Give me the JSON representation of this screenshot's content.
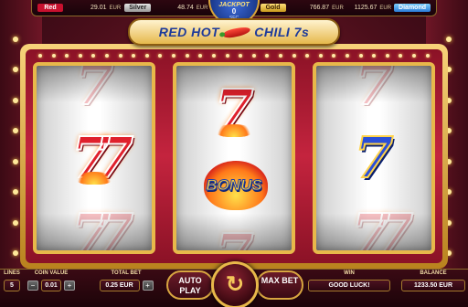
{
  "jackpots": [
    {
      "label": "Red",
      "value": "29.01",
      "currency": "EUR"
    },
    {
      "label": "Silver",
      "value": "48.74",
      "currency": "EUR"
    },
    {
      "label": "Gold",
      "value": "766.87",
      "currency": "EUR"
    },
    {
      "label": "Diamond",
      "value": "1125.67",
      "currency": "EUR"
    }
  ],
  "jackpot_badge": {
    "title": "JACKPOT",
    "number": "0",
    "unit": "SEC"
  },
  "title": {
    "part1": "RED HOT",
    "part2": "CHILI 7s"
  },
  "reels": [
    {
      "symbols": [
        "seven-red",
        "double-seven-red",
        "double-seven-red"
      ]
    },
    {
      "symbols": [
        "seven-red",
        "bonus",
        "seven-red"
      ]
    },
    {
      "symbols": [
        "seven-red",
        "seven-blue",
        "double-seven-red"
      ]
    }
  ],
  "bonus_label": "BONUS",
  "bottom": {
    "lines": {
      "caption": "LINES",
      "value": "5"
    },
    "coin_value": {
      "caption": "COIN VALUE",
      "value": "0.01",
      "minus": "−",
      "plus": "+"
    },
    "total_bet": {
      "caption": "TOTAL BET",
      "value": "0.25 EUR",
      "plus": "+"
    },
    "autoplay": "AUTO PLAY",
    "maxbet": "MAX BET",
    "win": {
      "caption": "WIN",
      "value": "GOOD LUCK!"
    },
    "balance": {
      "caption": "BALANCE",
      "value": "1233.50 EUR"
    }
  },
  "colors": {
    "red_jackpot": "#c8102e",
    "diamond_jackpot": "#2a7bd6",
    "frame_gold": "#e8b84a",
    "title_blue": "#1d3a9a"
  }
}
